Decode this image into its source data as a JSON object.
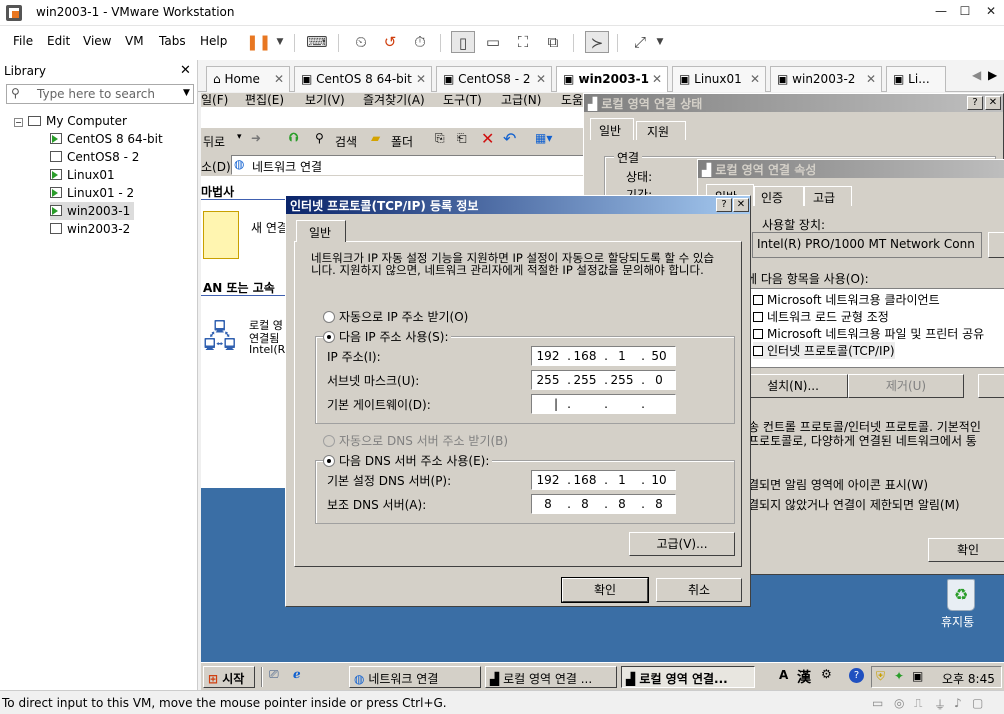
{
  "app": {
    "window_title": "win2003-1 - VMware Workstation",
    "menu": [
      "File",
      "Edit",
      "View",
      "VM",
      "Tabs",
      "Help"
    ]
  },
  "library": {
    "title": "Library",
    "search_placeholder": "Type here to search",
    "root": "My Computer",
    "vms": [
      {
        "label": "CentOS 8 64-bit",
        "running": true
      },
      {
        "label": "CentOS8 - 2",
        "running": false
      },
      {
        "label": "Linux01",
        "running": true
      },
      {
        "label": "Linux01 - 2",
        "running": true
      },
      {
        "label": "win2003-1",
        "running": true,
        "selected": true
      },
      {
        "label": "win2003-2",
        "running": false
      }
    ]
  },
  "tabs": [
    {
      "label": "Home",
      "icon": "home-icon"
    },
    {
      "label": "CentOS 8 64-bit",
      "icon": "vm-icon"
    },
    {
      "label": "CentOS8 - 2",
      "icon": "vm-icon"
    },
    {
      "label": "win2003-1",
      "icon": "vm-icon",
      "active": true
    },
    {
      "label": "Linux01",
      "icon": "vm-icon"
    },
    {
      "label": "win2003-2",
      "icon": "vm-icon"
    },
    {
      "label": "Li...",
      "icon": "vm-icon"
    }
  ],
  "explorer": {
    "title": "네트워크 연결",
    "menu": [
      "일(F)",
      "편집(E)",
      "보기(V)",
      "즐겨찾기(A)",
      "도구(T)",
      "고급(N)",
      "도움"
    ],
    "toolbar": {
      "back": "뒤로",
      "search": "검색",
      "folders": "폴더"
    },
    "address_label": "소(D)",
    "address_value": "네트워크 연결",
    "section1": "마법사",
    "new_connection": "새 연결",
    "section2": "AN 또는 고속",
    "conn_line1": "로컬 영",
    "conn_line2": "연결됨",
    "conn_line3": "Intel(R"
  },
  "status_window": {
    "title": "로컬 영역 연결 상태",
    "tabs": [
      "일반",
      "지원"
    ],
    "group": "연결",
    "row1": "상태:",
    "row2": "기간:"
  },
  "props_window": {
    "title": "로컬 영역 연결 속성",
    "tabs": [
      "일반",
      "인증",
      "고급"
    ],
    "device_label": "사용할 장치:",
    "device_value": "Intel(R) PRO/1000 MT Network Conn",
    "items_label": "에 다음 항목을 사용(O):",
    "items": [
      "Microsoft 네트워크용 클라이언트",
      "네트워크 로드 균형 조정",
      "Microsoft 네트워크용 파일 및 프린터 공유",
      "인터넷 프로토콜(TCP/IP)"
    ],
    "install_btn": "설치(N)...",
    "remove_btn": "제거(U)",
    "desc1": "송 컨트롤 프로토콜/인터넷 프로토콜. 기본적인",
    "desc2": "프로토콜로, 다양하게 연결된 네트워크에서 통",
    "check1": "결되면 알림 영역에 아이콘 표시(W)",
    "check2": "결되지 않았거나 연결이 제한되면 알림(M)",
    "ok_btn": "확인"
  },
  "tcpip_dialog": {
    "title": "인터넷 프로토콜(TCP/IP) 등록 정보",
    "tab": "일반",
    "description": "네트워크가 IP 자동 설정 기능을 지원하면 IP 설정이 자동으로 할당되도록 할 수 있습니다. 지원하지 않으면, 네트워크 관리자에게 적절한 IP 설정값을 문의해야 합니다.",
    "auto_ip": "자동으로 IP 주소 받기(O)",
    "manual_ip": "다음 IP 주소 사용(S):",
    "ip_label": "IP 주소(I):",
    "ip_value": [
      "192",
      "168",
      "1",
      "50"
    ],
    "subnet_label": "서브넷 마스크(U):",
    "subnet_value": [
      "255",
      "255",
      "255",
      "0"
    ],
    "gateway_label": "기본 게이트웨이(D):",
    "gateway_value": [
      "",
      "",
      "",
      ""
    ],
    "auto_dns": "자동으로 DNS 서버 주소 받기(B)",
    "manual_dns": "다음 DNS 서버 주소 사용(E):",
    "dns1_label": "기본 설정 DNS 서버(P):",
    "dns1_value": [
      "192",
      "168",
      "1",
      "10"
    ],
    "dns2_label": "보조 DNS 서버(A):",
    "dns2_value": [
      "8",
      "8",
      "8",
      "8"
    ],
    "advanced_btn": "고급(V)...",
    "ok_btn": "확인",
    "cancel_btn": "취소",
    "ip_mode": "manual",
    "dns_mode": "manual"
  },
  "desktop": {
    "recycle_bin": "휴지통"
  },
  "taskbar": {
    "start": "시작",
    "buttons": [
      "네트워크 연결",
      "로컬 영역 연결 ...",
      "로컬 영역 연결..."
    ],
    "ime1": "A",
    "ime2": "漢",
    "clock": "오후 8:45"
  },
  "statusbar": {
    "text": "To direct input to this VM, move the mouse pointer inside or press Ctrl+G."
  },
  "colors": {
    "xp_title_active": "#0a246a",
    "desktop": "#3a6ea5",
    "vmware_pause": "#e87722"
  }
}
